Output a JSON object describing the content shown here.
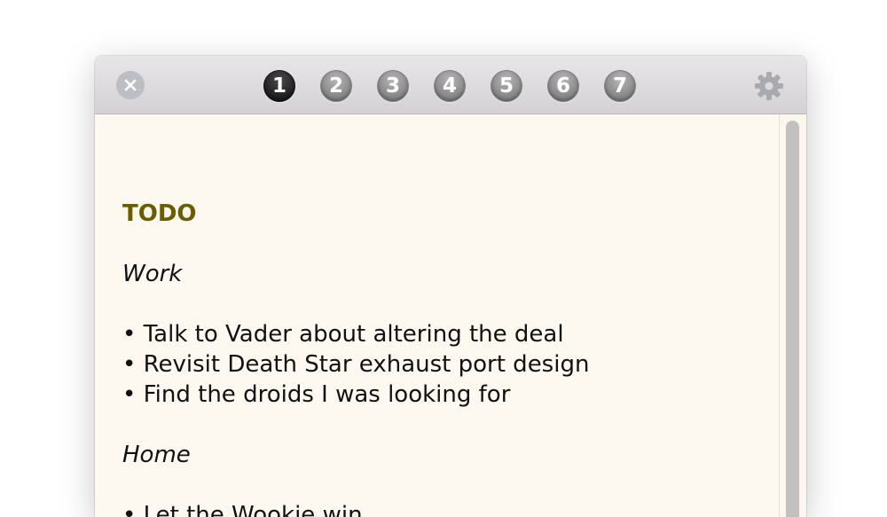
{
  "window": {
    "close_icon": "close-x-icon",
    "tabs": [
      {
        "label": "1",
        "active": true
      },
      {
        "label": "2",
        "active": false
      },
      {
        "label": "3",
        "active": false
      },
      {
        "label": "4",
        "active": false
      },
      {
        "label": "5",
        "active": false
      },
      {
        "label": "6",
        "active": false
      },
      {
        "label": "7",
        "active": false
      }
    ],
    "settings_icon": "gear-icon"
  },
  "note": {
    "title": "TODO",
    "sections": [
      {
        "heading": "Work",
        "items": [
          "• Talk to Vader about altering the deal",
          "• Revisit Death Star exhaust port design",
          "• Find the droids I was looking for"
        ]
      },
      {
        "heading": "Home",
        "items_parts": [
          {
            "before": "• Let the ",
            "misspelled": "Wookie",
            "after": " win"
          }
        ]
      }
    ]
  },
  "colors": {
    "title": "#6b5c00",
    "paper": "#fdf9f0",
    "active_tab": "#1e1e1e",
    "inactive_tab": "#8a8a8a"
  }
}
